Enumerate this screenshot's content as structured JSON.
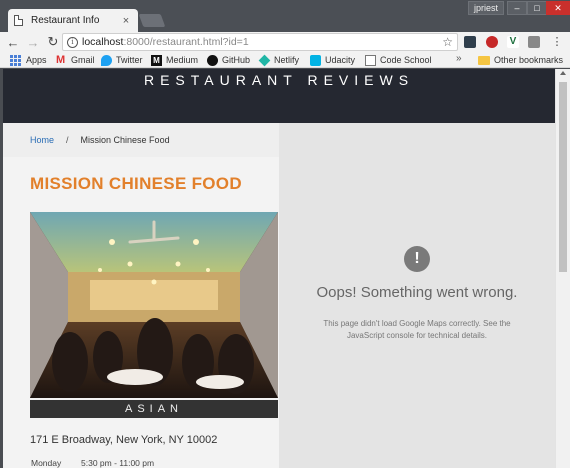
{
  "browser": {
    "tab_title": "Restaurant Info",
    "tab_close": "×",
    "user_name": "jpriest",
    "url_host": "localhost",
    "url_rest": ":8000/restaurant.html?id=1",
    "bookmarks": [
      {
        "label": "Apps"
      },
      {
        "label": "Gmail"
      },
      {
        "label": "Twitter"
      },
      {
        "label": "Medium"
      },
      {
        "label": "GitHub"
      },
      {
        "label": "Netlify"
      },
      {
        "label": "Udacity"
      },
      {
        "label": "Code School"
      }
    ],
    "bookmarks_overflow": "»",
    "other_bookmarks": "Other bookmarks"
  },
  "site": {
    "title": "RESTAURANT REVIEWS"
  },
  "breadcrumb": {
    "home": "Home",
    "separator": "/",
    "current": "Mission Chinese Food"
  },
  "restaurant": {
    "name": "MISSION CHINESE FOOD",
    "cuisine": "ASIAN",
    "address": "171 E Broadway, New York, NY 10002",
    "hours": [
      {
        "day": "Monday",
        "time": "5:30 pm - 11:00 pm"
      }
    ]
  },
  "map": {
    "error_icon": "!",
    "error_title": "Oops! Something went wrong.",
    "error_message": "This page didn't load Google Maps correctly. See the JavaScript console for technical details."
  },
  "colors": {
    "header_bg": "#252831",
    "restaurant_name": "#e2802b",
    "link": "#2a6db5"
  }
}
